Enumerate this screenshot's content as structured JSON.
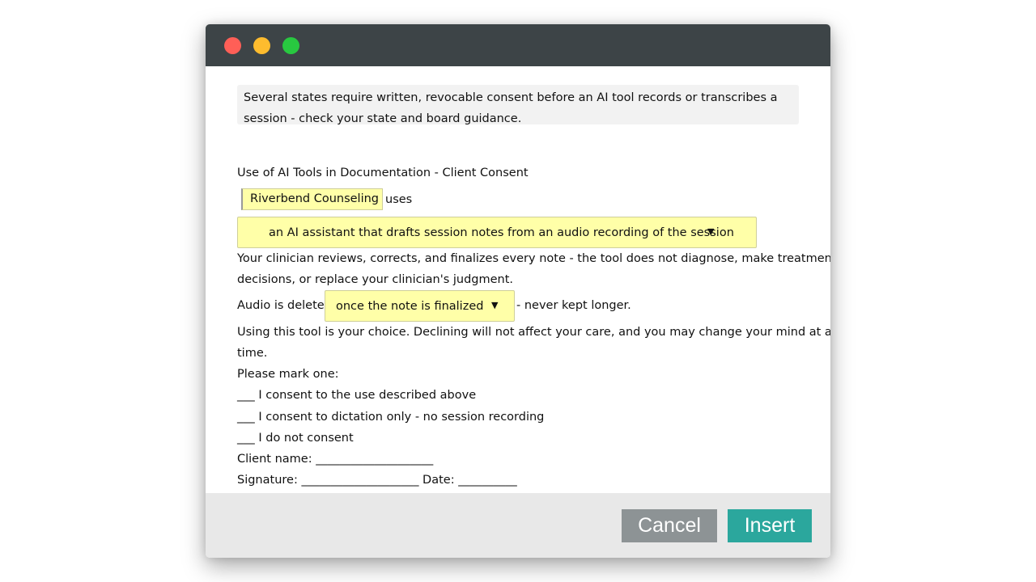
{
  "window": {
    "controls": [
      "close",
      "minimize",
      "zoom"
    ]
  },
  "form": {
    "notice": "Several states require written, revocable consent before an AI tool records or transcribes a session - check your state and board guidance.",
    "heading": "Use of AI Tools in Documentation - Client Consent",
    "agency_value": "Riverbend Counseling",
    "uses_text": "uses",
    "tool_select_value": "an AI assistant that drafts session notes from an audio recording of the session",
    "review_line1": "Your clinician reviews, corrects, and finalizes every note - the tool does not diagnose, make treatment",
    "review_line2": "decisions, or replace your clinician's judgment.",
    "audio_label": "Audio is deleted",
    "audio_select_value": "once the note is finalized",
    "audio_after": "- never kept longer.",
    "choice_line1": "Using this tool is your choice. Declining will not affect your care, and you may change your mind at any",
    "choice_line2": "time.",
    "mark_one": "Please mark one:",
    "options": [
      "___ I consent to the use described above",
      "___ I consent to dictation only - no session recording",
      "___ I do not consent"
    ],
    "client_name": "Client name: ____________________",
    "signature": "Signature: ____________________ Date: __________"
  },
  "footer": {
    "cancel_label": "Cancel",
    "insert_label": "Insert"
  },
  "colors": {
    "titlebar": "#3d4447",
    "field_highlight": "#ffffa8",
    "cancel": "#8d9395",
    "insert": "#2ba79d"
  },
  "icons": {
    "dropdown": "caret-down-icon"
  }
}
